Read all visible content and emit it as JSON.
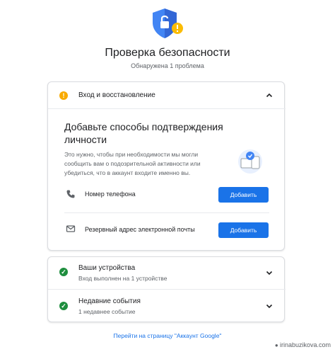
{
  "header": {
    "title": "Проверка безопасности",
    "subtitle": "Обнаружена 1 проблема"
  },
  "signin_section": {
    "title": "Вход и восстановление",
    "icon": "warning-icon",
    "status": "warning",
    "expanded": true,
    "heading": "Добавьте способы подтверждения личности",
    "description": "Это нужно, чтобы при необходимости мы могли сообщить вам о подозрительной активности или убедиться, что в аккаунт входите именно вы.",
    "rows": [
      {
        "icon": "phone-icon",
        "label": "Номер телефона",
        "button": "Добавить"
      },
      {
        "icon": "email-icon",
        "label": "Резервный адрес электронной почты",
        "button": "Добавить"
      }
    ]
  },
  "devices_section": {
    "title": "Ваши устройства",
    "subtitle": "Вход выполнен на 1 устройстве",
    "status": "ok"
  },
  "events_section": {
    "title": "Недавние события",
    "subtitle": "1 недавнее событие",
    "status": "ok"
  },
  "footer": {
    "link": "Перейти на страницу \"Аккаунт Google\""
  },
  "watermark": "irinabuzikova.com",
  "colors": {
    "accent": "#1a73e8",
    "warning": "#f9ab00",
    "success": "#1e8e3e",
    "text": "#202124",
    "secondary_text": "#5f6368"
  }
}
